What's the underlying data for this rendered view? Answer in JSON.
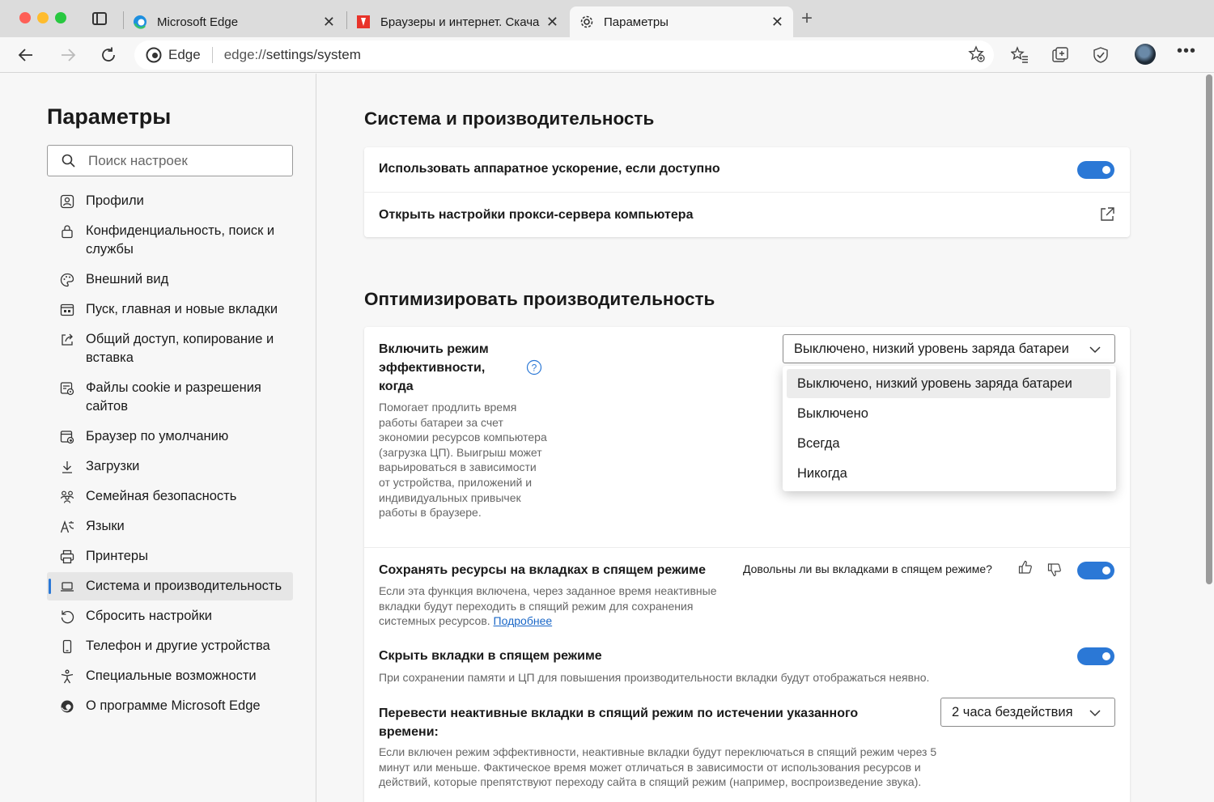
{
  "window": {
    "tabs": [
      {
        "title": "Microsoft Edge",
        "icon": "edge-icon"
      },
      {
        "title": "Браузеры и интернет. Скача",
        "icon": "site-favicon"
      },
      {
        "title": "Параметры",
        "icon": "gear-icon"
      }
    ]
  },
  "toolbar": {
    "brand": "Edge",
    "url_prefix": "edge://",
    "url_path": "settings/system"
  },
  "sidebar": {
    "title": "Параметры",
    "search_placeholder": "Поиск настроек",
    "items": [
      {
        "label": "Профили",
        "icon": "profile-icon"
      },
      {
        "label": "Конфиденциальность, поиск и службы",
        "icon": "lock-icon"
      },
      {
        "label": "Внешний вид",
        "icon": "palette-icon"
      },
      {
        "label": "Пуск, главная и новые вкладки",
        "icon": "home-tabs-icon"
      },
      {
        "label": "Общий доступ, копирование и вставка",
        "icon": "share-icon"
      },
      {
        "label": "Файлы cookie и разрешения сайтов",
        "icon": "cookie-permissions-icon"
      },
      {
        "label": "Браузер по умолчанию",
        "icon": "default-browser-icon"
      },
      {
        "label": "Загрузки",
        "icon": "download-icon"
      },
      {
        "label": "Семейная безопасность",
        "icon": "family-icon"
      },
      {
        "label": "Языки",
        "icon": "language-icon"
      },
      {
        "label": "Принтеры",
        "icon": "printer-icon"
      },
      {
        "label": "Система и производительность",
        "icon": "laptop-icon",
        "selected": true
      },
      {
        "label": "Сбросить настройки",
        "icon": "reset-icon"
      },
      {
        "label": "Телефон и другие устройства",
        "icon": "phone-icon"
      },
      {
        "label": "Специальные возможности",
        "icon": "accessibility-icon"
      },
      {
        "label": "О программе Microsoft Edge",
        "icon": "edge-icon"
      }
    ]
  },
  "main": {
    "section1": {
      "title": "Система и производительность",
      "hardware_accel": {
        "label": "Использовать аппаратное ускорение, если доступно",
        "enabled": true
      },
      "proxy": {
        "label": "Открыть настройки прокси-сервера компьютера"
      }
    },
    "section2": {
      "title": "Оптимизировать производительность",
      "efficiency": {
        "label": "Включить режим эффективности, когда",
        "description": "Помогает продлить время работы батареи за счет экономии ресурсов компьютера (загрузка ЦП). Выигрыш может варьироваться в зависимости от устройства, приложений и индивидуальных привычек работы в браузере.",
        "selected": "Выключено, низкий уровень заряда батареи",
        "options": [
          "Выключено, низкий уровень заряда батареи",
          "Выключено",
          "Всегда",
          "Никогда"
        ]
      },
      "sleeping_tabs": {
        "label": "Сохранять ресурсы на вкладках в спящем режиме",
        "feedback_question": "Довольны ли вы вкладками в спящем режиме?",
        "description": "Если эта функция включена, через заданное время неактивные вкладки будут переходить в спящий режим для сохранения системных ресурсов.",
        "link": "Подробнее",
        "enabled": true
      },
      "fade_tabs": {
        "label": "Скрыть вкладки в спящем режиме",
        "description": "При сохранении памяти и ЦП для повышения производительности вкладки будут отображаться неявно.",
        "enabled": true
      },
      "timeout": {
        "label": "Перевести неактивные вкладки в спящий режим по истечении указанного времени:",
        "selected": "2 часа бездействия",
        "description": "Если включен режим эффективности, неактивные вкладки будут переключаться в спящий режим через 5 минут или меньше. Фактическое время может отличаться в зависимости от использования ресурсов и действий, которые препятствуют переходу сайта в спящий режим (например, воспроизведение звука)."
      }
    }
  },
  "colors": {
    "accent": "#2b78d6",
    "link": "#1a67c7",
    "background": "#f7f7f7",
    "card": "#ffffff"
  }
}
